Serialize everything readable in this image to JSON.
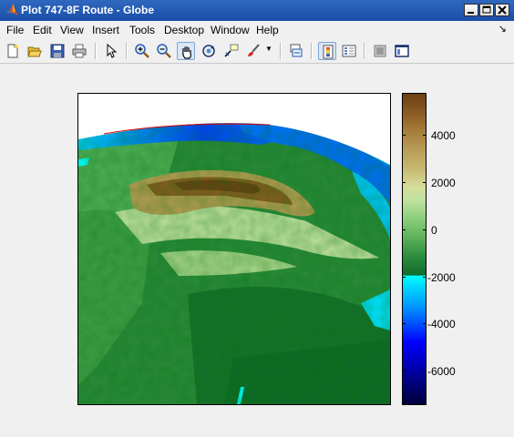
{
  "window": {
    "title": "Plot 747-8F Route - Globe",
    "controls": [
      "minimize",
      "maximize",
      "close"
    ]
  },
  "menu": {
    "items": [
      "File",
      "Edit",
      "View",
      "Insert",
      "Tools",
      "Desktop",
      "Window",
      "Help"
    ],
    "dock_arrow": "↘"
  },
  "toolbar": {
    "buttons": [
      {
        "name": "new-figure",
        "icon": "new-file-icon"
      },
      {
        "name": "open-file",
        "icon": "folder-open-icon"
      },
      {
        "name": "save-figure",
        "icon": "save-icon"
      },
      {
        "name": "print-figure",
        "icon": "printer-icon"
      },
      {
        "name": "edit-plot",
        "icon": "pointer-arrow-icon"
      },
      {
        "name": "zoom-in",
        "icon": "zoom-in-icon"
      },
      {
        "name": "zoom-out",
        "icon": "zoom-out-icon"
      },
      {
        "name": "pan",
        "icon": "hand-icon",
        "active": true
      },
      {
        "name": "rotate-3d",
        "icon": "rotate-icon"
      },
      {
        "name": "data-cursor",
        "icon": "data-cursor-icon"
      },
      {
        "name": "brush",
        "icon": "brush-icon"
      },
      {
        "name": "link-plot",
        "icon": "link-icon"
      },
      {
        "name": "insert-colorbar",
        "icon": "colorbar-icon",
        "active": true
      },
      {
        "name": "insert-legend",
        "icon": "legend-icon"
      },
      {
        "name": "hide-plot-tools",
        "icon": "hide-tools-icon"
      },
      {
        "name": "show-plot-tools",
        "icon": "show-tools-icon"
      }
    ]
  },
  "colorbar": {
    "tick_labels": [
      "4000",
      "2000",
      "0",
      "-2000",
      "-4000",
      "-6000"
    ],
    "colors": {
      "top": "#6b4014",
      "land_mid": "#2f8f3e",
      "sea_level_land": "#126b2c",
      "sea_level_ocean": "#00ffff",
      "ocean_mid": "#0000ff",
      "bottom": "#00003a"
    }
  }
}
